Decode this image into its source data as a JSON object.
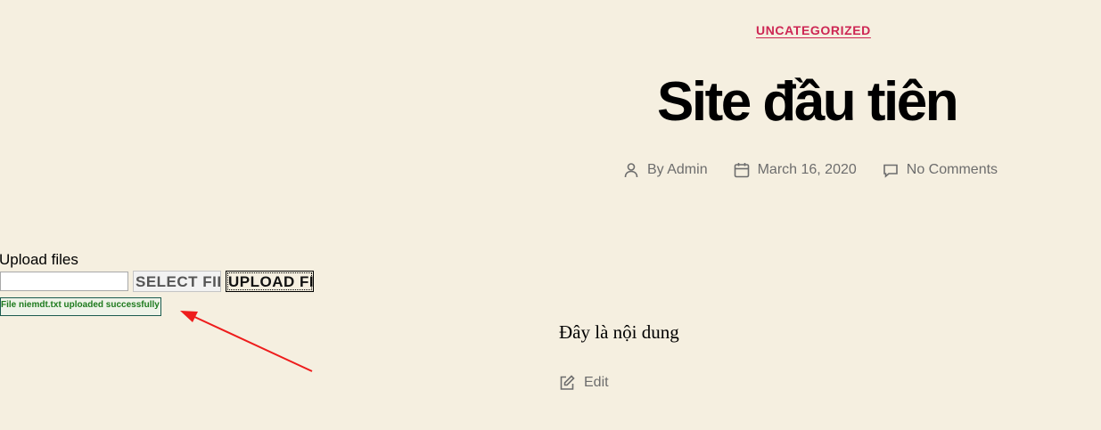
{
  "post": {
    "category": "UNCATEGORIZED",
    "title": "Site đầu tiên",
    "author": "By Admin",
    "date": "March 16, 2020",
    "comments": "No Comments",
    "content": "Đây là nội dung",
    "edit_label": "Edit"
  },
  "upload": {
    "label": "Upload files",
    "file_value": "",
    "select_button": "SELECT FILE",
    "upload_button": "UPLOAD FILE",
    "status": "File niemdt.txt uploaded successfully"
  },
  "annotation": {
    "arrow_color": "#ee1c1c"
  },
  "colors": {
    "background": "#f5efe0",
    "accent": "#cd2653",
    "meta": "#6d6d6d",
    "success": "#1d7a1d"
  }
}
